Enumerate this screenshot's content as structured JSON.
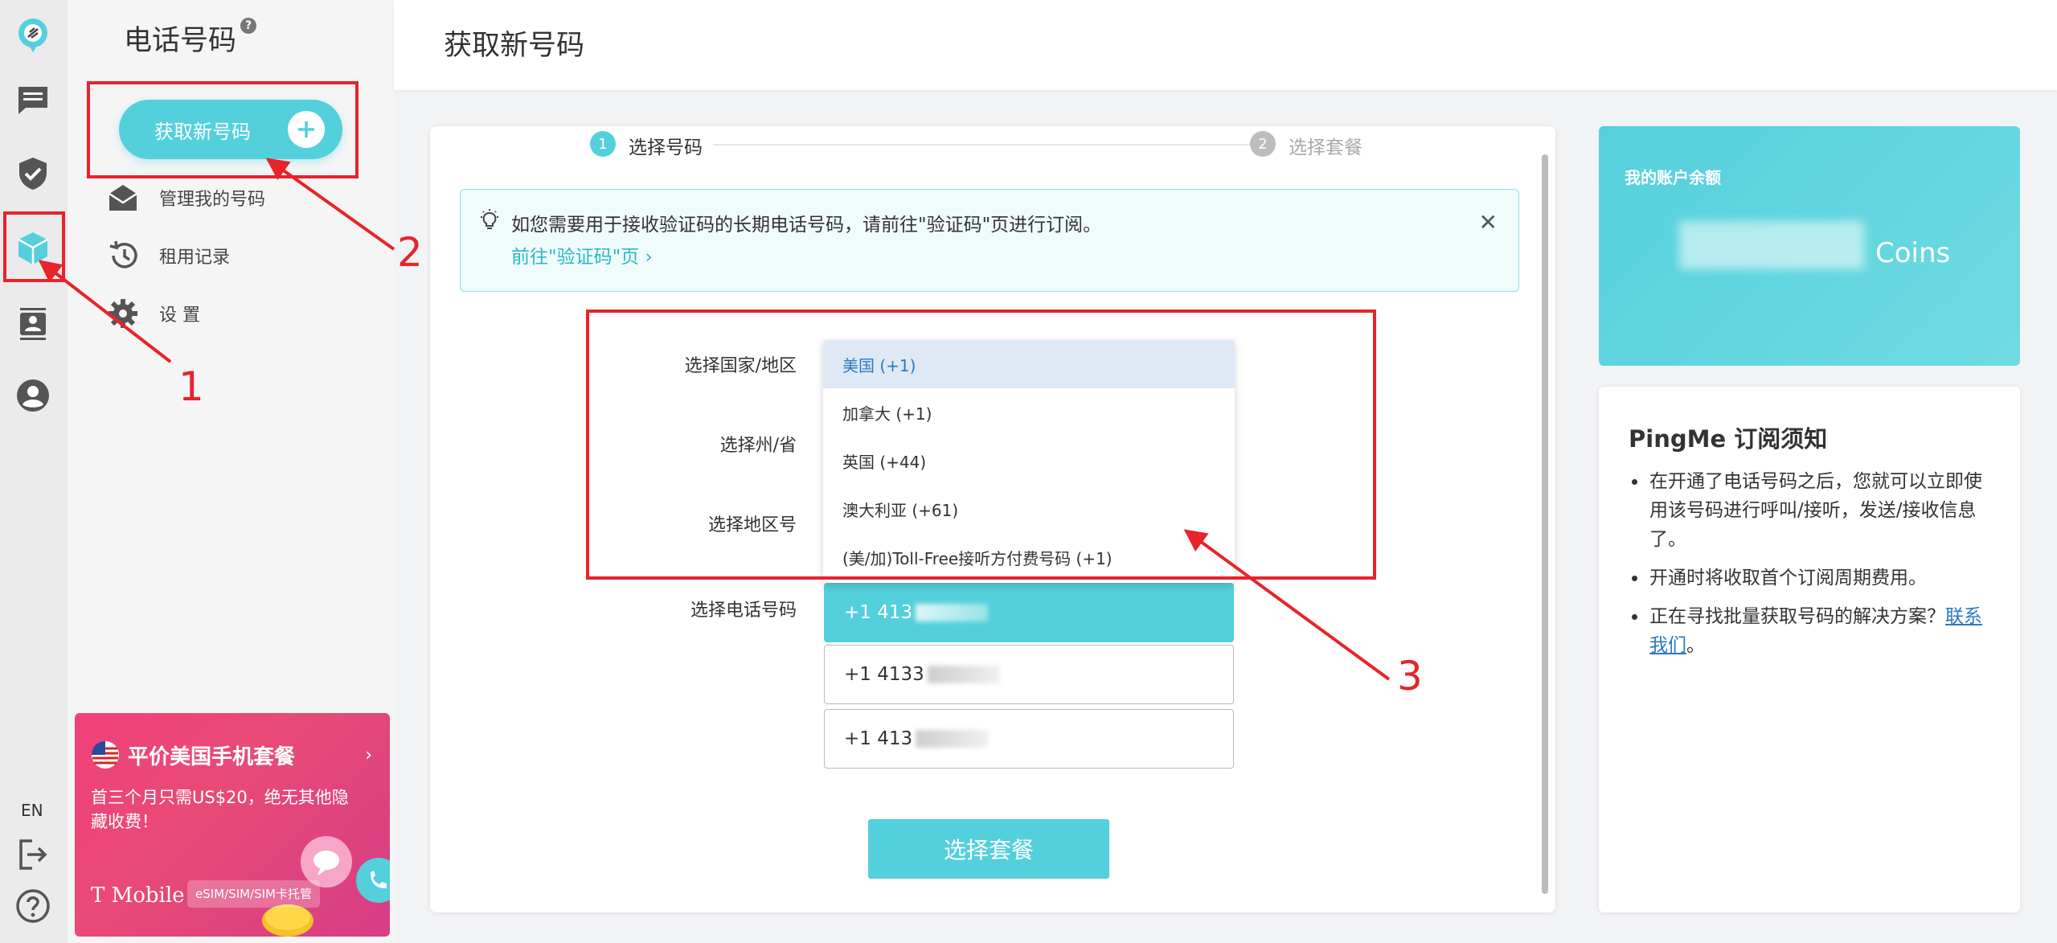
{
  "sidebar": {
    "title": "电话号码",
    "help": "?",
    "get_number_button": "获取新号码",
    "items": [
      {
        "label": "管理我的号码"
      },
      {
        "label": "租用记录"
      },
      {
        "label": "设 置"
      }
    ],
    "promo": {
      "title": "平价美国手机套餐",
      "subtitle": "首三个月只需US$20，绝无其他隐藏收费！",
      "brand": "T Mobile",
      "tag": "eSIM/SIM/SIM卡托管"
    },
    "language": "EN"
  },
  "page": {
    "title": "获取新号码"
  },
  "steps": [
    {
      "num": "1",
      "label": "选择号码"
    },
    {
      "num": "2",
      "label": "选择套餐"
    }
  ],
  "notice": {
    "text": "如您需要用于接收验证码的长期电话号码，请前往\"验证码\"页进行订阅。",
    "link": "前往\"验证码\"页 ›"
  },
  "form": {
    "country_label": "选择国家/地区",
    "state_label": "选择州/省",
    "area_label": "选择地区号",
    "phone_label": "选择电话号码",
    "country_options": [
      "美国 (+1)",
      "加拿大 (+1)",
      "英国 (+44)",
      "澳大利亚 (+61)",
      "(美/加)Toll-Free接听方付费号码 (+1)"
    ],
    "phone_options": [
      "+1 413",
      "+1 4133",
      "+1 413"
    ],
    "submit": "选择套餐"
  },
  "balance": {
    "label": "我的账户余额",
    "unit": "Coins"
  },
  "tips": {
    "title": "PingMe 订阅须知",
    "items": [
      "在开通了电话号码之后，您就可以立即使用该号码进行呼叫/接听，发送/接收信息了。",
      "开通时将收取首个订阅周期费用。"
    ],
    "item3_text": "正在寻找批量获取号码的解决方案？",
    "item3_link": "联系我们",
    "item3_end": "。"
  },
  "annotations": [
    "1",
    "2",
    "3"
  ],
  "colors": {
    "accent": "#54d0dc",
    "annotation": "#e8232a",
    "link": "#2a79c4"
  }
}
